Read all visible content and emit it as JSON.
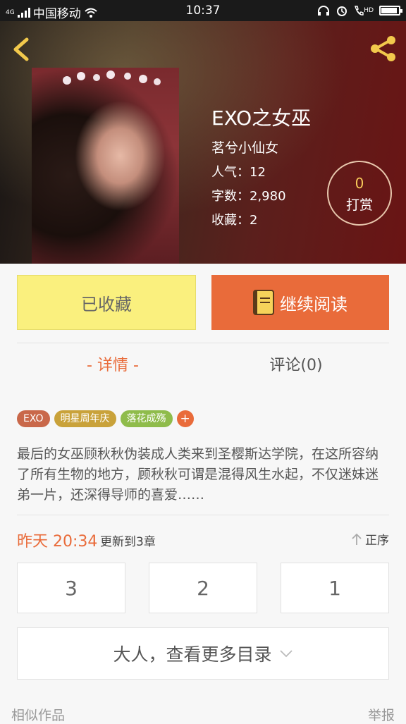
{
  "status_bar": {
    "network": "4G",
    "carrier": "中国移动",
    "time": "10:37",
    "hd": "HD",
    "battery_level": 0.92
  },
  "book": {
    "title": "EXO之女巫",
    "author": "茗兮小仙女",
    "popularity": "人气：12",
    "word_count": "字数：2,980",
    "favorites": "收藏：2",
    "reward_count": "0",
    "reward_label": "打赏"
  },
  "actions": {
    "favorited_label": "已收藏",
    "continue_reading_label": "继续阅读"
  },
  "tabs": {
    "detail_label": "详情",
    "comments_label": "评论(0)"
  },
  "tags": [
    {
      "label": "EXO",
      "color": "#c9684a"
    },
    {
      "label": "明星周年庆",
      "color": "#c9a23a"
    },
    {
      "label": "落花成殇",
      "color": "#8fbc4b"
    }
  ],
  "tag_add": "+",
  "description": "最后的女巫顾秋秋伪装成人类来到圣樱斯达学院，在这所容纳了所有生物的地方，顾秋秋可谓是混得风生水起，不仅迷妹迷弟一片，还深得导师的喜爱……",
  "update": {
    "time": "昨天 20:34",
    "text": "更新到3章",
    "sort_label": "正序"
  },
  "chapters": [
    "3",
    "2",
    "1"
  ],
  "more_toc_label": "大人，查看更多目录",
  "footer": {
    "similar_label": "相似作品",
    "report_label": "举报"
  },
  "colors": {
    "accent": "#e96b3a",
    "favorited_bg": "#faf07e",
    "reward_count": "#f7c95a"
  }
}
